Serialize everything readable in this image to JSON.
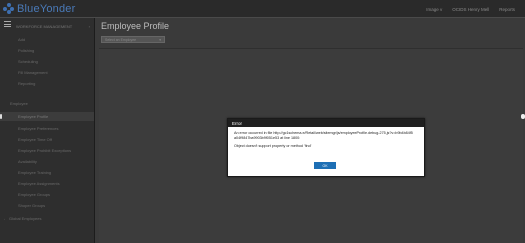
{
  "app": {
    "brand": "BlueYonder"
  },
  "topbar": {
    "items": [
      "Image v",
      "OCIDS Henry Mell",
      "Reports"
    ]
  },
  "sidebar": {
    "header": "WORKFORCE MANAGEMENT",
    "items": [
      {
        "label": "Add"
      },
      {
        "label": "Polishing"
      },
      {
        "label": "Scheduling"
      },
      {
        "label": "Fill Management"
      },
      {
        "label": "Reporting"
      },
      {
        "label": "Employee"
      },
      {
        "label": "Employee Profile"
      },
      {
        "label": "Employee Preferences"
      },
      {
        "label": "Employee Time Off"
      },
      {
        "label": "Employee Prohibit Exceptions"
      },
      {
        "label": "Availability"
      },
      {
        "label": "Employee Training"
      },
      {
        "label": "Employee Assignments"
      },
      {
        "label": "Employee Groups"
      },
      {
        "label": "Shoper Groups"
      },
      {
        "label": "Global Employees"
      }
    ]
  },
  "main": {
    "title": "Employee Profile",
    "select_placeholder": "Select an Employee"
  },
  "dialog": {
    "title": "Error",
    "message1": "An error occurred in file http://gc1schema.e/Retail/web/sitemgr/js/employeeProfile.debug-275,js?v=b9b4b84f5a04f9847ba9903b9f051e53 at line 1800:",
    "message2": "Object doesn't support property or method 'find'",
    "ok_label": "OK"
  }
}
